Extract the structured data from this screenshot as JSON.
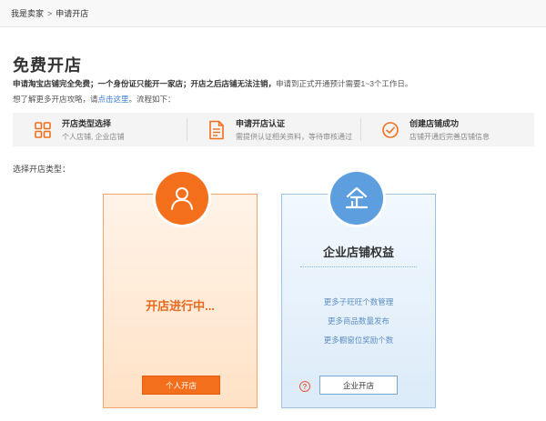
{
  "breadcrumb": {
    "parent": "我是卖家",
    "separator": ">",
    "current": "申请开店"
  },
  "page": {
    "title": "免费开店",
    "desc_bold": "申请淘宝店铺完全免费；一个身份证只能开一家店；开店之后店铺无法注销，",
    "desc_note": "申请到正式开通预计需要1~3个工作日。",
    "guide_prefix": "想了解更多开店攻略，请",
    "guide_link": "点击这里",
    "guide_suffix": "。流程如下："
  },
  "steps": [
    {
      "icon": "grid-icon",
      "title": "开店类型选择",
      "subtitle": "个人店铺, 企业店铺"
    },
    {
      "icon": "document-icon",
      "title": "申请开店认证",
      "subtitle": "需提供认证相关资料，等待审核通过"
    },
    {
      "icon": "check-circle-icon",
      "title": "创建店铺成功",
      "subtitle": "店铺开通后完善店铺信息"
    }
  ],
  "choose_label": "选择开店类型：",
  "personal": {
    "icon": "person-icon",
    "status": "开店进行中...",
    "button": "个人开店"
  },
  "enterprise": {
    "icon": "enterprise-icon",
    "title": "企业店铺权益",
    "benefits": [
      "更多子旺旺个数管理",
      "更多商品数量发布",
      "更多橱窗位奖励个数"
    ],
    "help_symbol": "?",
    "button": "企业开店"
  },
  "colors": {
    "accent_orange": "#f36f1c",
    "accent_blue": "#5d9fde",
    "link_blue": "#3a7ed6"
  }
}
